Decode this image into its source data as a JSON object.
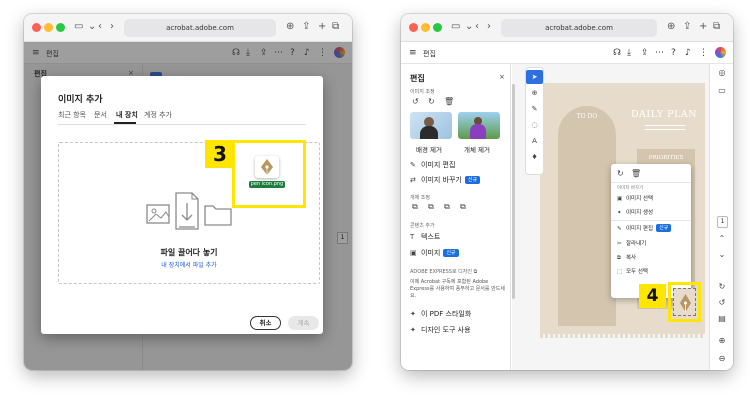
{
  "browser": {
    "url": "acrobat.adobe.com"
  },
  "left_window": {
    "bg_panel_title": "편집",
    "bg_panel_close": "×",
    "bg_page_number": "1",
    "dialog": {
      "title": "이미지 추가",
      "tabs": [
        "최근 항목",
        "문서",
        "내 장치",
        "계정 추가"
      ],
      "active_tab": "내 장치",
      "drop_title": "파일 끌어다 놓기",
      "drop_link": "내 장치에서 파일 추가",
      "cancel_label": "취소",
      "continue_label": "계속"
    },
    "dragged_file": "pen icon.png",
    "step_number": "3"
  },
  "right_window": {
    "panel": {
      "title": "편집",
      "close": "×",
      "sections": {
        "image_adjust": "이미지 조정",
        "object_adjust": "개체 조정",
        "add_content": "콘텐츠 추가",
        "express": "ADOBE EXPRESS로 디자인"
      },
      "thumb_labels": [
        "배경 제거",
        "개체 제거"
      ],
      "items": {
        "edit_image": "이미지 편집",
        "replace_image": "이미지 바꾸기",
        "text": "텍스트",
        "image": "이미지",
        "pdf_style": "이 PDF 스타일화",
        "design_tool": "디자인 도구 사용"
      },
      "new_badge": "신규",
      "express_desc": "이제 Acrobat 구독에 포함된 Adobe Express를 사용하여 풍부하고 문서를 만드세요."
    },
    "document": {
      "title": "DAILY PLAN",
      "todo": "TO DO",
      "priorities": "PRIORITIES"
    },
    "context_menu": {
      "section": "이미지 바꾸기",
      "items": [
        "이미지 선택",
        "이미지 생성",
        "이미지 편집",
        "잘라내기",
        "복사",
        "모두 선택"
      ],
      "new_badge": "신규"
    },
    "page_number": "1",
    "step_number": "4"
  },
  "colors": {
    "highlight": "#ffe600",
    "accent_blue": "#2d6fe0",
    "paper": "#e7dccb"
  }
}
